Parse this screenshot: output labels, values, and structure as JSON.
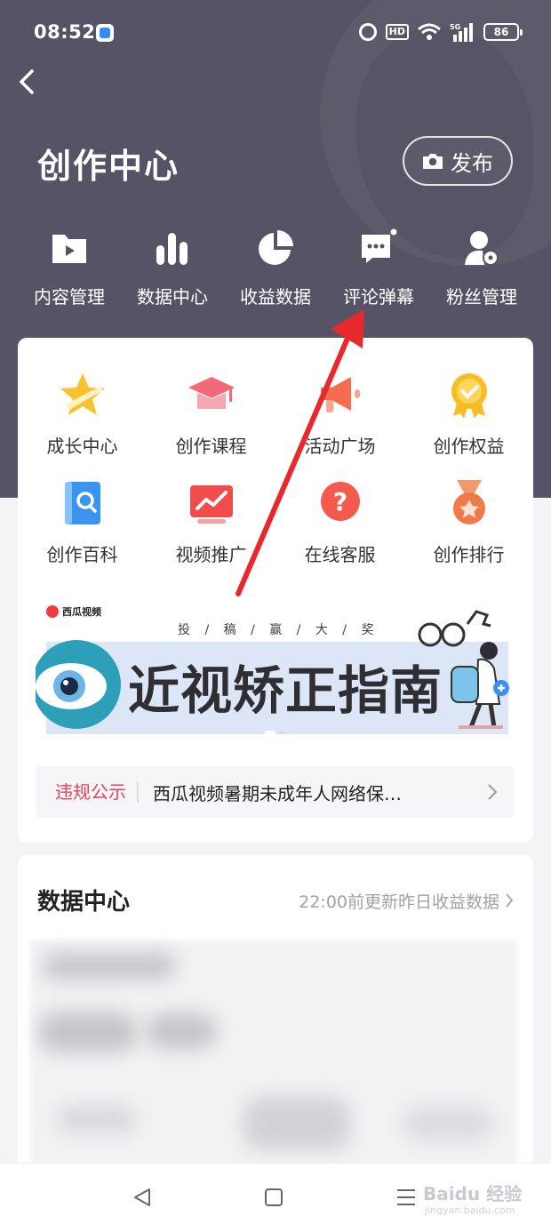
{
  "status_bar": {
    "time": "08:52",
    "hd": "HD",
    "network": "5G",
    "battery": "86"
  },
  "header": {
    "title": "创作中心",
    "publish_label": "发布"
  },
  "top_nav": [
    {
      "label": "内容管理",
      "icon": "video-folder-icon"
    },
    {
      "label": "数据中心",
      "icon": "bar-chart-icon"
    },
    {
      "label": "收益数据",
      "icon": "pie-chart-icon"
    },
    {
      "label": "评论弹幕",
      "icon": "comment-bubble-icon"
    },
    {
      "label": "粉丝管理",
      "icon": "fan-user-icon"
    }
  ],
  "tools": [
    {
      "label": "成长中心",
      "icon": "star-icon"
    },
    {
      "label": "创作课程",
      "icon": "graduation-cap-icon"
    },
    {
      "label": "活动广场",
      "icon": "megaphone-icon"
    },
    {
      "label": "创作权益",
      "icon": "medal-check-icon"
    },
    {
      "label": "创作百科",
      "icon": "book-search-icon"
    },
    {
      "label": "视频推广",
      "icon": "trend-icon"
    },
    {
      "label": "在线客服",
      "icon": "question-icon"
    },
    {
      "label": "创作排行",
      "icon": "rank-medal-icon"
    }
  ],
  "banner": {
    "brand": "西瓜视频",
    "subtitle": "投 / 稿 / 赢 / 大 / 奖",
    "title": "近视矫正指南"
  },
  "notice": {
    "tag": "违规公示",
    "text": "西瓜视频暑期未成年人网络保…"
  },
  "data_center": {
    "title": "数据中心",
    "note": "22:00前更新昨日收益数据"
  },
  "watermark": {
    "text": "Baidu 经验",
    "sub": "jingyan.baidu.com"
  },
  "colors": {
    "header_bg": "#575366",
    "accent_red": "#e8425c",
    "arrow_red": "#e8282a"
  }
}
